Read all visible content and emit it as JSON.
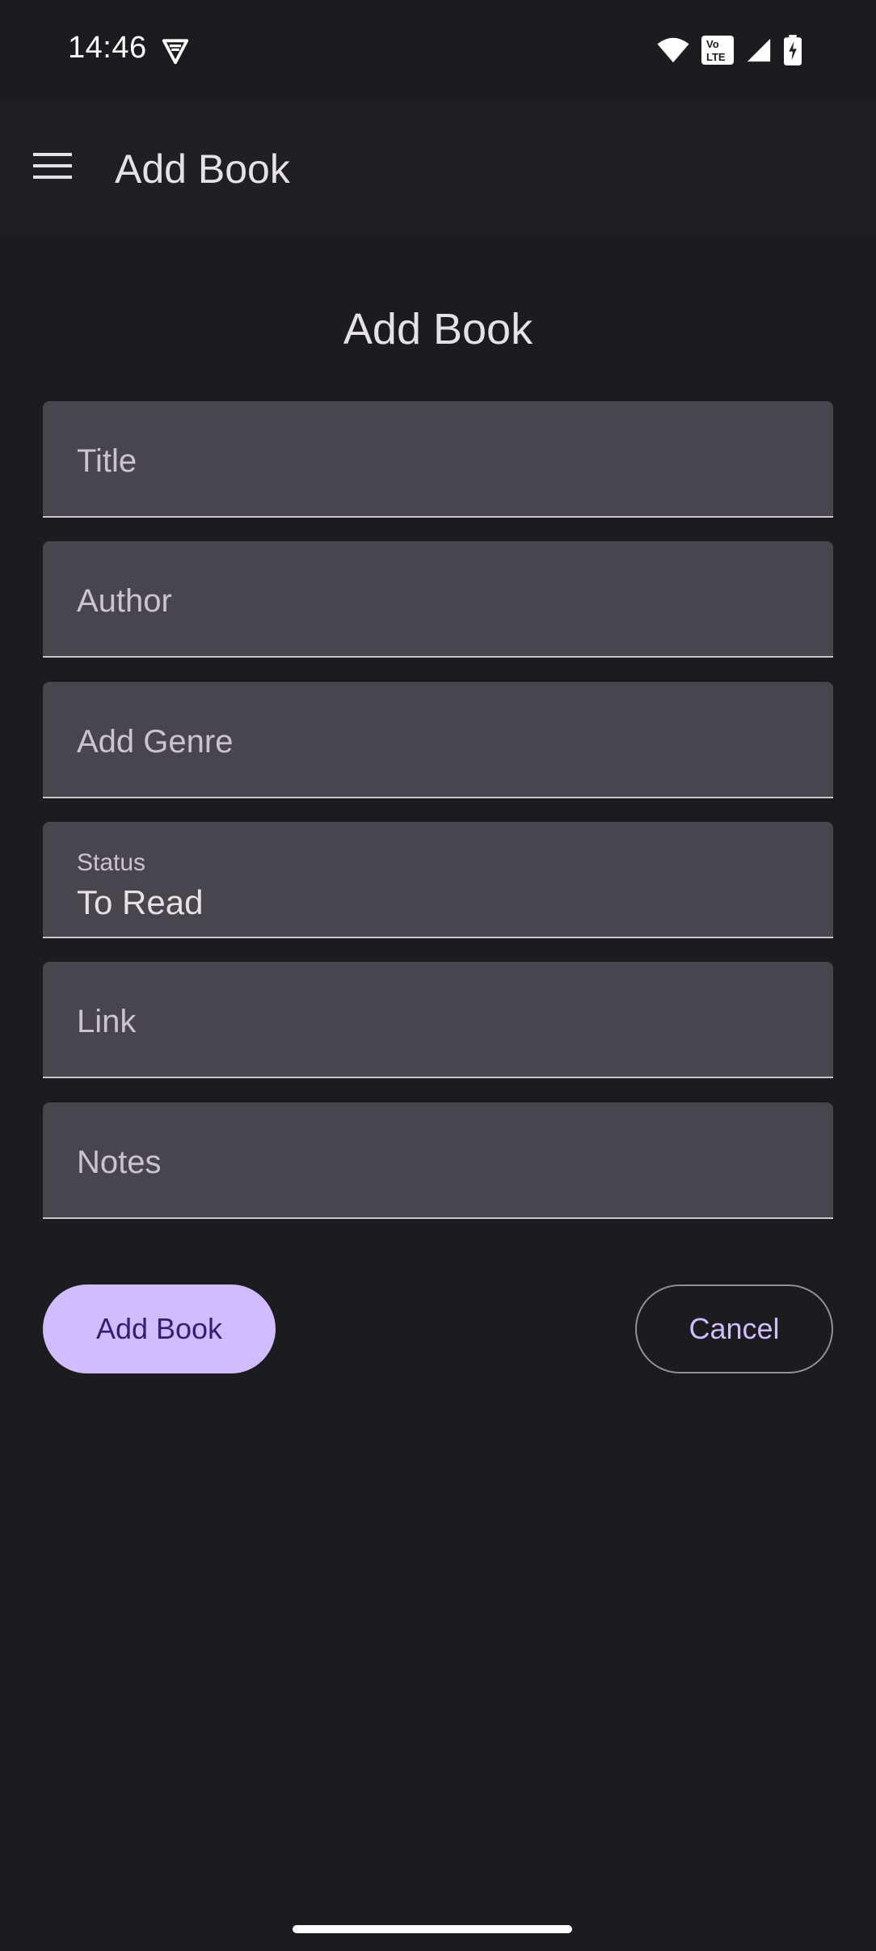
{
  "status_bar": {
    "time": "14:46",
    "icons": [
      "vpn-icon",
      "wifi-icon",
      "volte-icon",
      "signal-icon",
      "battery-charging-icon"
    ],
    "volte_text": "Vo LTE"
  },
  "app_bar": {
    "title": "Add Book",
    "menu_icon": "menu-icon"
  },
  "form": {
    "heading": "Add Book",
    "fields": {
      "title": {
        "placeholder": "Title"
      },
      "author": {
        "placeholder": "Author"
      },
      "genre": {
        "placeholder": "Add Genre"
      },
      "status": {
        "label": "Status",
        "value": "To Read"
      },
      "link": {
        "placeholder": "Link"
      },
      "notes": {
        "placeholder": "Notes"
      }
    },
    "add_button_label": "Add Book",
    "cancel_button_label": "Cancel"
  },
  "colors": {
    "background": "#1c1b1f",
    "field_background": "#49454f",
    "primary": "#d0bcff",
    "on_primary": "#381e72"
  }
}
